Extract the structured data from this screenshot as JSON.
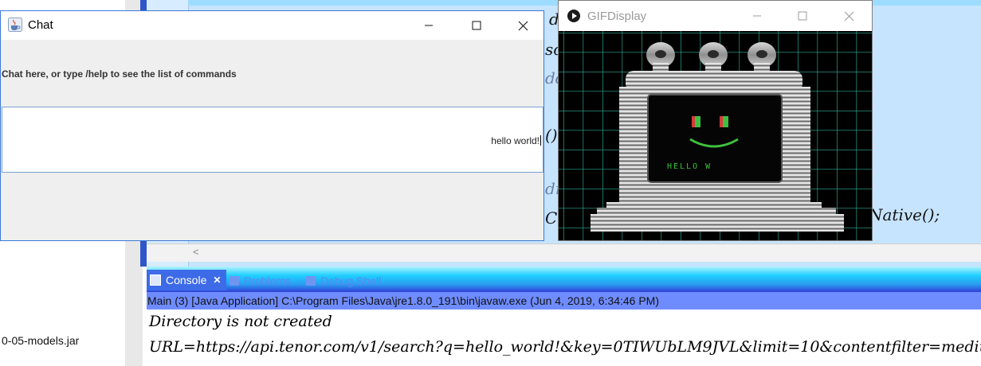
{
  "ide": {
    "jar_label": "0-05-models.jar",
    "code_fragments": [
      "g",
      "d",
      "sc",
      "dd",
      "()",
      "dr",
      "C",
      "Native();"
    ],
    "console_tabs": [
      {
        "label": "Console",
        "close": "✕"
      },
      {
        "label": "Problems"
      },
      {
        "label": "Debug Shell"
      }
    ],
    "console_header": "Main (3) [Java Application] C:\\Program Files\\Java\\jre1.8.0_191\\bin\\javaw.exe (Jun 4, 2019, 6:34:46 PM)",
    "console_lines": [
      "Directory is not created",
      "URL=https://api.tenor.com/v1/search?q=hello_world!&key=0TIWUbLM9JVL&limit=10&contentfilter=medium"
    ],
    "scroll_arrow": "<"
  },
  "chat": {
    "title": "Chat",
    "prompt": "Chat here, or type /help to see the list of commands",
    "input_value": "hello world!",
    "controls": {
      "minimize": "—",
      "maximize": "☐",
      "close": "✕"
    }
  },
  "gif": {
    "title": "GIFDisplay",
    "screen_text": "HELLO W",
    "controls": {
      "minimize": "—",
      "maximize": "☐",
      "close": "✕"
    }
  },
  "colors": {
    "chat_border": "#3a78d8",
    "editor_bg": "#c7e4ff",
    "console_header_bg": "#6f8cff",
    "gif_grid": "#2fae9a",
    "gif_text": "#39c039"
  }
}
